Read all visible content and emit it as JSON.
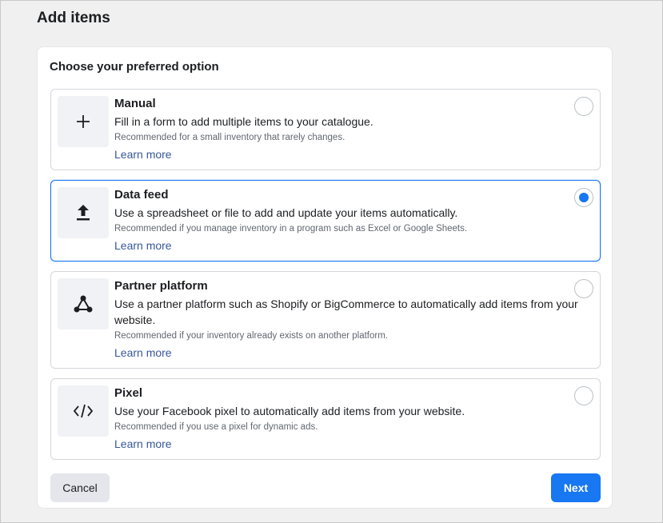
{
  "page": {
    "title": "Add items"
  },
  "card": {
    "heading": "Choose your preferred option"
  },
  "options": [
    {
      "title": "Manual",
      "description": "Fill in a form to add multiple items to your catalogue.",
      "recommendation": "Recommended for a small inventory that rarely changes.",
      "link": "Learn more",
      "icon": "plus-icon",
      "selected": false
    },
    {
      "title": "Data feed",
      "description": "Use a spreadsheet or file to add and update your items automatically.",
      "recommendation": "Recommended if you manage inventory in a program such as Excel or Google Sheets.",
      "link": "Learn more",
      "icon": "upload-icon",
      "selected": true
    },
    {
      "title": "Partner platform",
      "description": "Use a partner platform such as Shopify or BigCommerce to automatically add items from your website.",
      "recommendation": "Recommended if your inventory already exists on another platform.",
      "link": "Learn more",
      "icon": "network-icon",
      "selected": false
    },
    {
      "title": "Pixel",
      "description": "Use your Facebook pixel to automatically add items from your website.",
      "recommendation": "Recommended if you use a pixel for dynamic ads.",
      "link": "Learn more",
      "icon": "code-icon",
      "selected": false
    }
  ],
  "buttons": {
    "cancel": "Cancel",
    "next": "Next"
  },
  "colors": {
    "accent": "#1877f2",
    "link": "#385898",
    "background": "#f0f2f5"
  }
}
